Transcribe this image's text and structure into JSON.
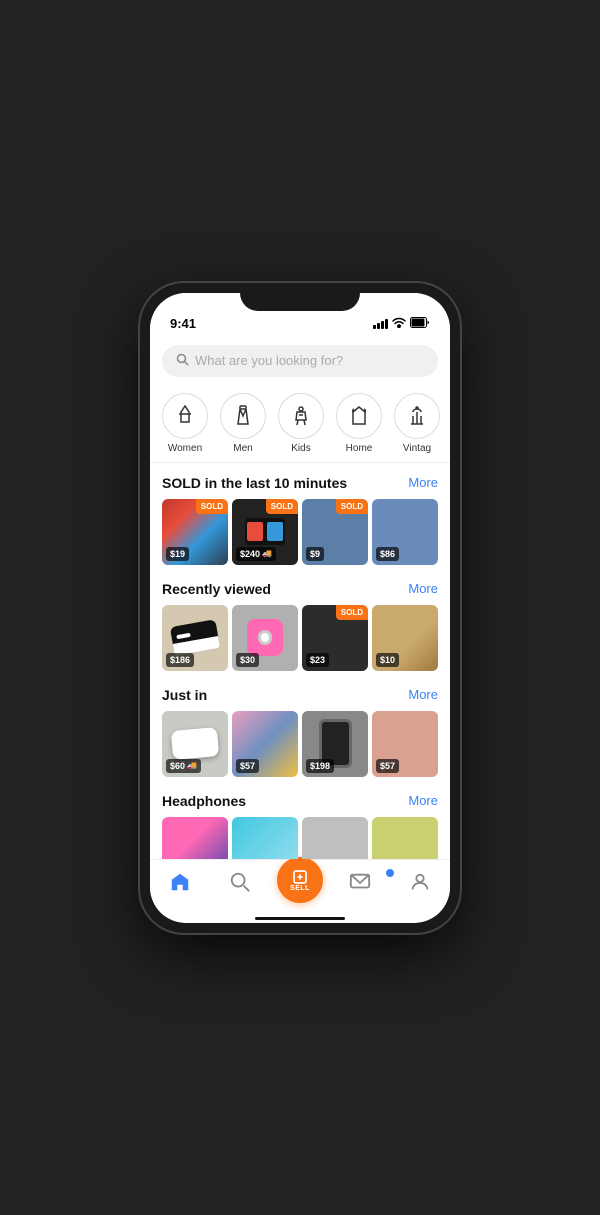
{
  "statusBar": {
    "time": "9:41"
  },
  "search": {
    "placeholder": "What are you looking for?"
  },
  "categories": [
    {
      "id": "women",
      "label": "Women",
      "icon": "dress"
    },
    {
      "id": "men",
      "label": "Men",
      "icon": "tie"
    },
    {
      "id": "kids",
      "label": "Kids",
      "icon": "onesie"
    },
    {
      "id": "home",
      "label": "Home",
      "icon": "home"
    },
    {
      "id": "vintage",
      "label": "Vintag",
      "icon": "candles"
    }
  ],
  "sections": [
    {
      "id": "sold",
      "title": "SOLD in the last 10 minutes",
      "more": "More",
      "items": [
        {
          "price": "$19",
          "sold": true,
          "shipping": false,
          "bg": "bg-plaid"
        },
        {
          "price": "$240",
          "sold": true,
          "shipping": true,
          "bg": "bg-switch"
        },
        {
          "price": "$9",
          "sold": true,
          "shipping": false,
          "bg": "bg-jeans"
        },
        {
          "price": "$86",
          "sold": false,
          "shipping": false,
          "bg": "bg-sunglasses"
        }
      ]
    },
    {
      "id": "recently-viewed",
      "title": "Recently viewed",
      "more": "More",
      "items": [
        {
          "price": "$186",
          "sold": false,
          "shipping": false,
          "bg": "bg-sneakers"
        },
        {
          "price": "$30",
          "sold": false,
          "shipping": false,
          "bg": "bg-camera"
        },
        {
          "price": "$23",
          "sold": true,
          "shipping": false,
          "bg": "bg-coffee"
        },
        {
          "price": "$10",
          "sold": false,
          "shipping": false,
          "bg": "bg-heartsunglasses"
        }
      ]
    },
    {
      "id": "just-in",
      "title": "Just in",
      "more": "More",
      "items": [
        {
          "price": "$60",
          "sold": false,
          "shipping": true,
          "bg": "bg-whitesneak"
        },
        {
          "price": "$57",
          "sold": false,
          "shipping": false,
          "bg": "bg-bedding"
        },
        {
          "price": "$198",
          "sold": false,
          "shipping": false,
          "bg": "bg-phone"
        },
        {
          "price": "$57",
          "sold": false,
          "shipping": false,
          "bg": "bg-pinkshoes"
        }
      ]
    },
    {
      "id": "headphones",
      "title": "Headphones",
      "more": "More",
      "items": [
        {
          "price": "",
          "sold": false,
          "shipping": false,
          "bg": "bg-pinkheadphones"
        },
        {
          "price": "",
          "sold": false,
          "shipping": false,
          "bg": "bg-blueheadphones"
        },
        {
          "price": "",
          "sold": false,
          "shipping": false,
          "bg": "bg-grayheadphones"
        },
        {
          "price": "",
          "sold": false,
          "shipping": false,
          "bg": "bg-yellowheadphones"
        }
      ]
    }
  ],
  "nav": {
    "home": "Home",
    "search": "Search",
    "sell": "SELL",
    "messages": "Messages",
    "profile": "Profile"
  },
  "labels": {
    "sold": "SOLD"
  }
}
